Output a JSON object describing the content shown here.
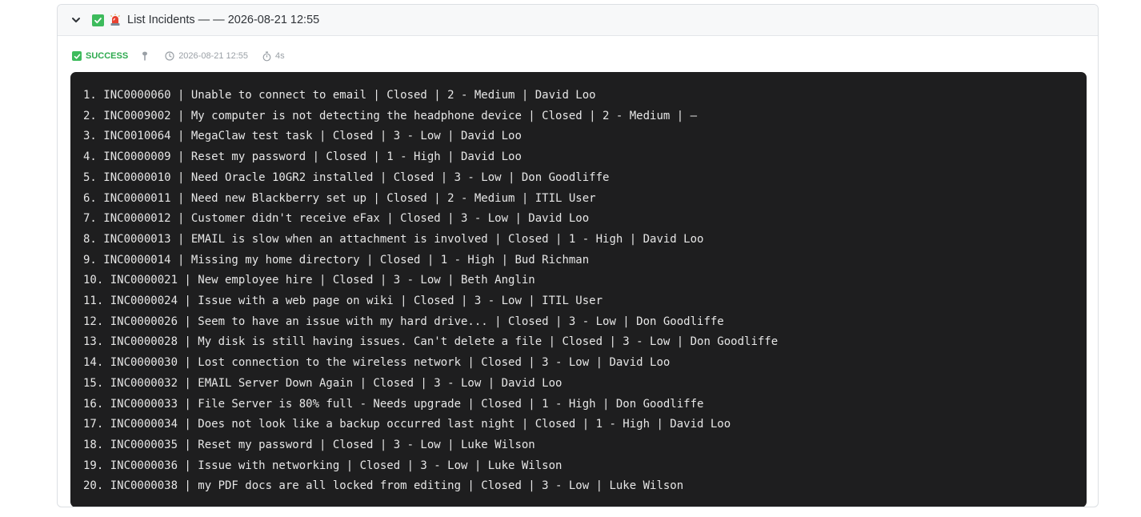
{
  "header": {
    "title": "List Incidents — — 2026-08-21 12:55",
    "chevron_icon": "chevron-down-icon",
    "status_icon": "check-square-icon",
    "tool_icon": "siren-icon"
  },
  "meta": {
    "status_label": "SUCCESS",
    "timestamp": "2026-08-21 12:55",
    "duration": "4s"
  },
  "colors": {
    "success": "#3dbb5c",
    "console_bg": "#1e1e1f"
  },
  "output": {
    "lines": [
      "1. INC0000060 | Unable to connect to email | Closed | 2 - Medium | David Loo",
      "2. INC0009002 | My computer is not detecting the headphone device | Closed | 2 - Medium | —",
      "3. INC0010064 | MegaClaw test task | Closed | 3 - Low | David Loo",
      "4. INC0000009 | Reset my password | Closed | 1 - High | David Loo",
      "5. INC0000010 | Need Oracle 10GR2 installed | Closed | 3 - Low | Don Goodliffe",
      "6. INC0000011 | Need new Blackberry set up | Closed | 2 - Medium | ITIL User",
      "7. INC0000012 | Customer didn't receive eFax | Closed | 3 - Low | David Loo",
      "8. INC0000013 | EMAIL is slow when an attachment is involved | Closed | 1 - High | David Loo",
      "9. INC0000014 | Missing my home directory | Closed | 1 - High | Bud Richman",
      "10. INC0000021 | New employee hire | Closed | 3 - Low | Beth Anglin",
      "11. INC0000024 | Issue with a web page on wiki | Closed | 3 - Low | ITIL User",
      "12. INC0000026 | Seem to have an issue with my hard drive... | Closed | 3 - Low | Don Goodliffe",
      "13. INC0000028 | My disk is still having issues. Can't delete a file | Closed | 3 - Low | Don Goodliffe",
      "14. INC0000030 | Lost connection to the wireless network | Closed | 3 - Low | David Loo",
      "15. INC0000032 | EMAIL Server Down Again | Closed | 3 - Low | David Loo",
      "16. INC0000033 | File Server is 80% full - Needs upgrade | Closed | 1 - High | Don Goodliffe",
      "17. INC0000034 | Does not look like a backup occurred last night | Closed | 1 - High | David Loo",
      "18. INC0000035 | Reset my password | Closed | 3 - Low | Luke Wilson",
      "19. INC0000036 | Issue with networking | Closed | 3 - Low | Luke Wilson",
      "20. INC0000038 | my PDF docs are all locked from editing | Closed | 3 - Low | Luke Wilson"
    ]
  }
}
